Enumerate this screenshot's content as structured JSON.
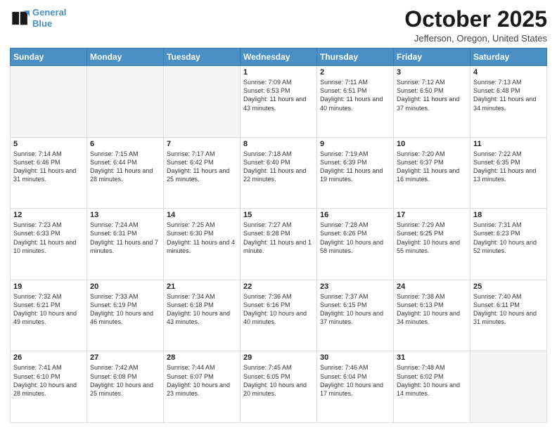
{
  "header": {
    "logo_line1": "General",
    "logo_line2": "Blue",
    "month": "October 2025",
    "location": "Jefferson, Oregon, United States"
  },
  "weekdays": [
    "Sunday",
    "Monday",
    "Tuesday",
    "Wednesday",
    "Thursday",
    "Friday",
    "Saturday"
  ],
  "rows": [
    [
      {
        "day": "",
        "info": ""
      },
      {
        "day": "",
        "info": ""
      },
      {
        "day": "",
        "info": ""
      },
      {
        "day": "1",
        "info": "Sunrise: 7:09 AM\nSunset: 6:53 PM\nDaylight: 11 hours\nand 43 minutes."
      },
      {
        "day": "2",
        "info": "Sunrise: 7:11 AM\nSunset: 6:51 PM\nDaylight: 11 hours\nand 40 minutes."
      },
      {
        "day": "3",
        "info": "Sunrise: 7:12 AM\nSunset: 6:50 PM\nDaylight: 11 hours\nand 37 minutes."
      },
      {
        "day": "4",
        "info": "Sunrise: 7:13 AM\nSunset: 6:48 PM\nDaylight: 11 hours\nand 34 minutes."
      }
    ],
    [
      {
        "day": "5",
        "info": "Sunrise: 7:14 AM\nSunset: 6:46 PM\nDaylight: 11 hours\nand 31 minutes."
      },
      {
        "day": "6",
        "info": "Sunrise: 7:15 AM\nSunset: 6:44 PM\nDaylight: 11 hours\nand 28 minutes."
      },
      {
        "day": "7",
        "info": "Sunrise: 7:17 AM\nSunset: 6:42 PM\nDaylight: 11 hours\nand 25 minutes."
      },
      {
        "day": "8",
        "info": "Sunrise: 7:18 AM\nSunset: 6:40 PM\nDaylight: 11 hours\nand 22 minutes."
      },
      {
        "day": "9",
        "info": "Sunrise: 7:19 AM\nSunset: 6:39 PM\nDaylight: 11 hours\nand 19 minutes."
      },
      {
        "day": "10",
        "info": "Sunrise: 7:20 AM\nSunset: 6:37 PM\nDaylight: 11 hours\nand 16 minutes."
      },
      {
        "day": "11",
        "info": "Sunrise: 7:22 AM\nSunset: 6:35 PM\nDaylight: 11 hours\nand 13 minutes."
      }
    ],
    [
      {
        "day": "12",
        "info": "Sunrise: 7:23 AM\nSunset: 6:33 PM\nDaylight: 11 hours\nand 10 minutes."
      },
      {
        "day": "13",
        "info": "Sunrise: 7:24 AM\nSunset: 6:31 PM\nDaylight: 11 hours\nand 7 minutes."
      },
      {
        "day": "14",
        "info": "Sunrise: 7:25 AM\nSunset: 6:30 PM\nDaylight: 11 hours\nand 4 minutes."
      },
      {
        "day": "15",
        "info": "Sunrise: 7:27 AM\nSunset: 6:28 PM\nDaylight: 11 hours\nand 1 minute."
      },
      {
        "day": "16",
        "info": "Sunrise: 7:28 AM\nSunset: 6:26 PM\nDaylight: 10 hours\nand 58 minutes."
      },
      {
        "day": "17",
        "info": "Sunrise: 7:29 AM\nSunset: 6:25 PM\nDaylight: 10 hours\nand 55 minutes."
      },
      {
        "day": "18",
        "info": "Sunrise: 7:31 AM\nSunset: 6:23 PM\nDaylight: 10 hours\nand 52 minutes."
      }
    ],
    [
      {
        "day": "19",
        "info": "Sunrise: 7:32 AM\nSunset: 6:21 PM\nDaylight: 10 hours\nand 49 minutes."
      },
      {
        "day": "20",
        "info": "Sunrise: 7:33 AM\nSunset: 6:19 PM\nDaylight: 10 hours\nand 46 minutes."
      },
      {
        "day": "21",
        "info": "Sunrise: 7:34 AM\nSunset: 6:18 PM\nDaylight: 10 hours\nand 43 minutes."
      },
      {
        "day": "22",
        "info": "Sunrise: 7:36 AM\nSunset: 6:16 PM\nDaylight: 10 hours\nand 40 minutes."
      },
      {
        "day": "23",
        "info": "Sunrise: 7:37 AM\nSunset: 6:15 PM\nDaylight: 10 hours\nand 37 minutes."
      },
      {
        "day": "24",
        "info": "Sunrise: 7:38 AM\nSunset: 6:13 PM\nDaylight: 10 hours\nand 34 minutes."
      },
      {
        "day": "25",
        "info": "Sunrise: 7:40 AM\nSunset: 6:11 PM\nDaylight: 10 hours\nand 31 minutes."
      }
    ],
    [
      {
        "day": "26",
        "info": "Sunrise: 7:41 AM\nSunset: 6:10 PM\nDaylight: 10 hours\nand 28 minutes."
      },
      {
        "day": "27",
        "info": "Sunrise: 7:42 AM\nSunset: 6:08 PM\nDaylight: 10 hours\nand 25 minutes."
      },
      {
        "day": "28",
        "info": "Sunrise: 7:44 AM\nSunset: 6:07 PM\nDaylight: 10 hours\nand 23 minutes."
      },
      {
        "day": "29",
        "info": "Sunrise: 7:45 AM\nSunset: 6:05 PM\nDaylight: 10 hours\nand 20 minutes."
      },
      {
        "day": "30",
        "info": "Sunrise: 7:46 AM\nSunset: 6:04 PM\nDaylight: 10 hours\nand 17 minutes."
      },
      {
        "day": "31",
        "info": "Sunrise: 7:48 AM\nSunset: 6:02 PM\nDaylight: 10 hours\nand 14 minutes."
      },
      {
        "day": "",
        "info": ""
      }
    ]
  ]
}
